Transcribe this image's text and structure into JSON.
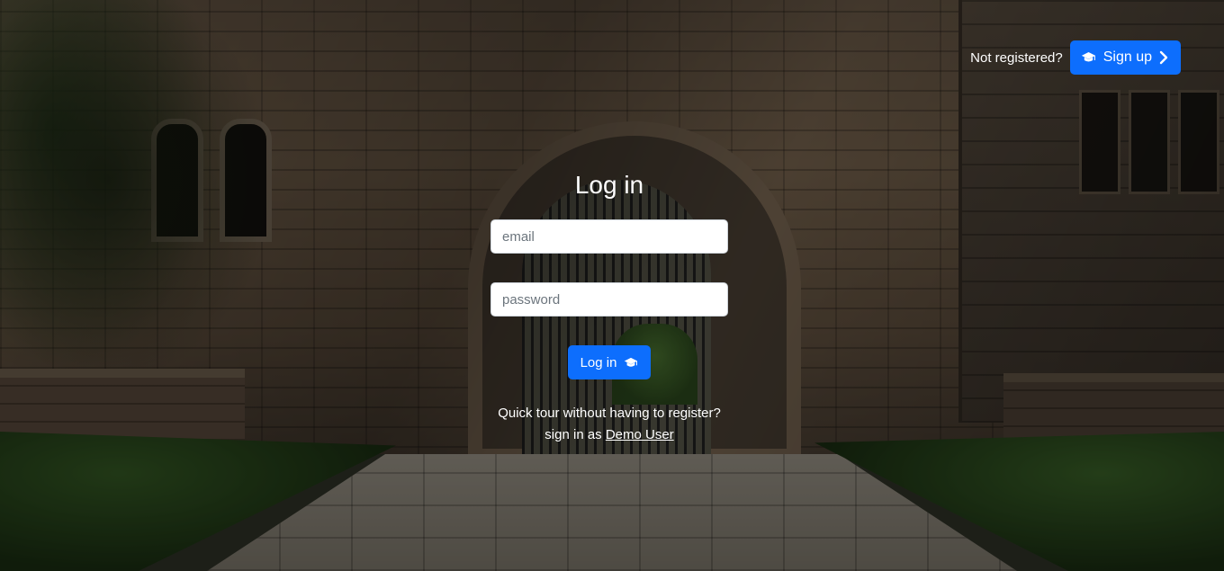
{
  "header": {
    "not_registered_text": "Not registered?",
    "signup_label": "Sign up",
    "signup_icon": "graduation-cap-icon",
    "signup_chevron_icon": "chevron-right-icon"
  },
  "login": {
    "title": "Log in",
    "email_placeholder": "email",
    "password_placeholder": "password",
    "submit_label": "Log in",
    "submit_icon": "graduation-cap-icon"
  },
  "demo": {
    "line1": "Quick tour without having to register?",
    "line2_prefix": "sign in as",
    "link_label": "Demo User"
  },
  "colors": {
    "primary_button": "#0d6efd",
    "text": "#ffffff"
  }
}
